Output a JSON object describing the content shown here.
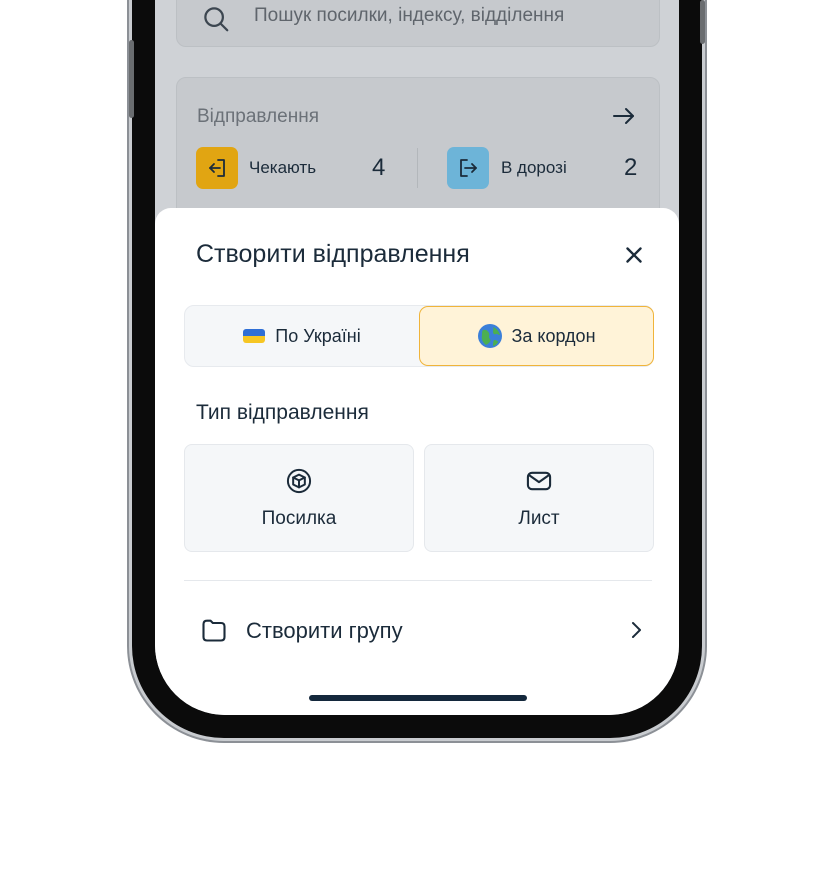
{
  "search": {
    "placeholder": "Пошук посилки, індексу, відділення"
  },
  "shipments": {
    "title": "Відправлення",
    "waiting_label": "Чекають",
    "waiting_count": "4",
    "in_transit_label": "В дорозі",
    "in_transit_count": "2",
    "colors": {
      "waiting": "#e1a512",
      "in_transit": "#6db4d8"
    }
  },
  "sheet": {
    "title": "Створити відправлення",
    "close_icon": "close-icon",
    "segments": [
      {
        "label": "По Україні",
        "icon": "ukraine-flag-icon",
        "selected": false
      },
      {
        "label": "За кордон",
        "icon": "globe-icon",
        "selected": true
      }
    ],
    "type_label": "Тип відправлення",
    "types": [
      {
        "label": "Посилка",
        "icon": "package-icon"
      },
      {
        "label": "Лист",
        "icon": "envelope-icon"
      }
    ],
    "group": {
      "label": "Створити групу",
      "icon": "folder-icon"
    }
  },
  "colors": {
    "accent": "#f0b43a",
    "accent_bg": "#fff3d8",
    "text": "#1b2b3a"
  }
}
